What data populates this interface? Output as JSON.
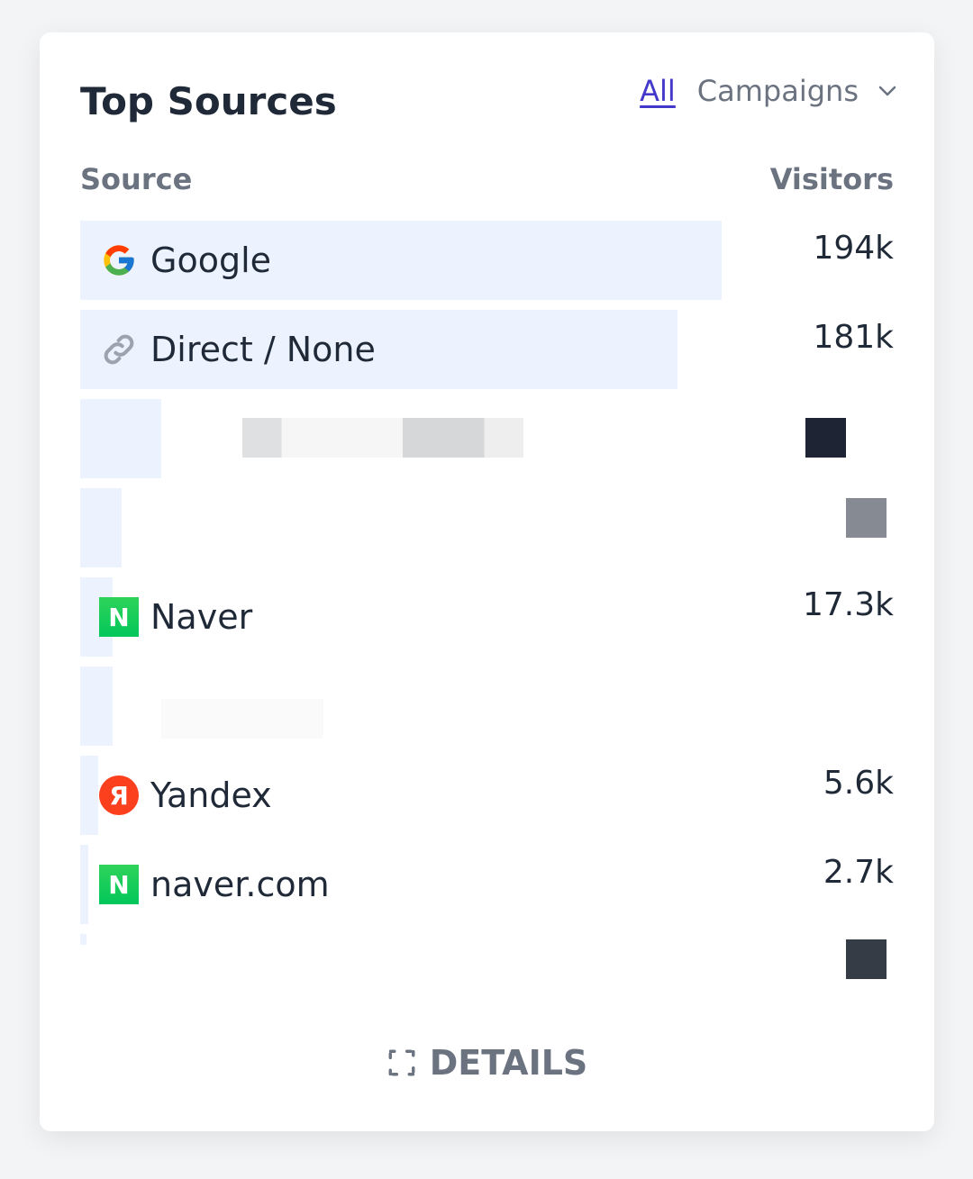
{
  "header": {
    "title": "Top Sources",
    "tab_all": "All",
    "tab_campaigns": "Campaigns"
  },
  "columns": {
    "source": "Source",
    "visitors": "Visitors"
  },
  "rows": [
    {
      "label": "Google",
      "value": "194k",
      "icon": "google-icon",
      "share": 1.0
    },
    {
      "label": "Direct / None",
      "value": "181k",
      "icon": "link-icon",
      "share": 0.93
    },
    {
      "label": "",
      "value": "",
      "icon": "",
      "share": 0.1
    },
    {
      "label": "",
      "value": "",
      "icon": "",
      "share": 0.06
    },
    {
      "label": "Naver",
      "value": "17.3k",
      "icon": "naver-icon",
      "share": 0.05
    },
    {
      "label": "",
      "value": "",
      "icon": "",
      "share": 0.05
    },
    {
      "label": "Yandex",
      "value": "5.6k",
      "icon": "yandex-icon",
      "share": 0.03
    },
    {
      "label": "naver.com",
      "value": "2.7k",
      "icon": "naver-icon",
      "share": 0.01
    },
    {
      "label": "",
      "value": "",
      "icon": "",
      "share": 0.01
    }
  ],
  "footer": {
    "details_label": "DETAILS"
  },
  "colors": {
    "accent": "#4338ca",
    "bar": "#ecf3fe",
    "text": "#1f2937",
    "muted": "#6b7280"
  }
}
